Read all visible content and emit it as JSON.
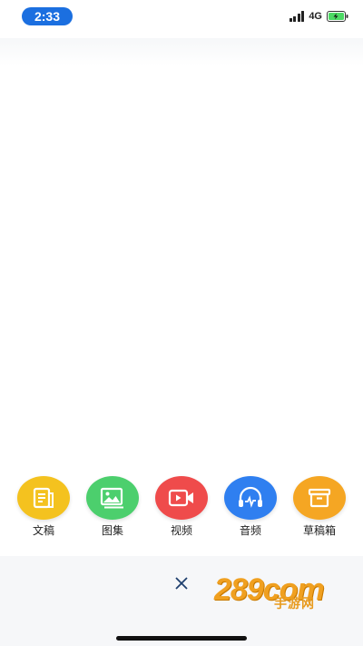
{
  "status_bar": {
    "time": "2:33",
    "network": "4G",
    "icons": [
      "signal-icon",
      "battery-charging-icon"
    ]
  },
  "tools": [
    {
      "label": "文稿",
      "icon": "document-icon",
      "color": "#f4c21f"
    },
    {
      "label": "图集",
      "icon": "image-icon",
      "color": "#4ccf6d"
    },
    {
      "label": "视频",
      "icon": "video-camera-icon",
      "color": "#ef4b4b"
    },
    {
      "label": "音频",
      "icon": "headphones-icon",
      "color": "#2f7ff0"
    },
    {
      "label": "草稿箱",
      "icon": "archive-box-icon",
      "color": "#f5a623"
    }
  ],
  "close": {
    "icon": "close-icon"
  },
  "watermark": {
    "main": "289com",
    "sub": "手游网"
  }
}
